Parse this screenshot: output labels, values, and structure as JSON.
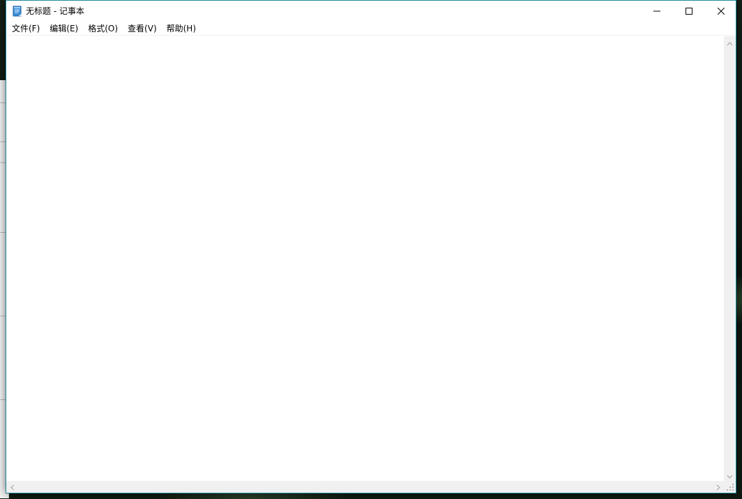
{
  "window": {
    "title": "无标题 - 记事本"
  },
  "menu": {
    "items": [
      {
        "label": "文件(F)"
      },
      {
        "label": "编辑(E)"
      },
      {
        "label": "格式(O)"
      },
      {
        "label": "查看(V)"
      },
      {
        "label": "帮助(H)"
      }
    ]
  },
  "editor": {
    "text": ""
  },
  "icons": {
    "app": "notepad-icon",
    "minimize": "minimize-icon",
    "maximize": "maximize-icon",
    "close": "close-icon",
    "scroll_up": "chevron-up-icon",
    "scroll_down": "chevron-down-icon",
    "scroll_left": "chevron-left-icon",
    "scroll_right": "chevron-right-icon",
    "size_grip": "resize-grip-icon"
  },
  "colors": {
    "window_border": "#1f8a9e",
    "titlebar_bg": "#ffffff",
    "scrollbar_bg": "#f0f0f0"
  }
}
